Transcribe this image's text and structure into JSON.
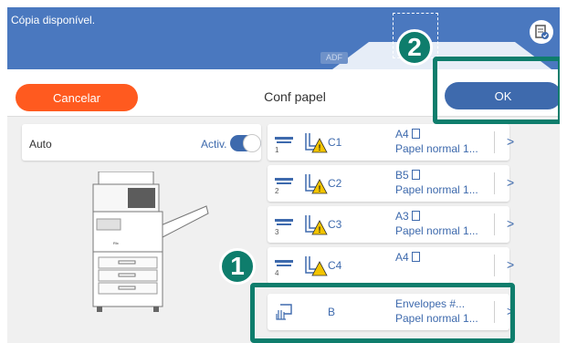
{
  "header": {
    "status": "Cópia disponível.",
    "adf_label": "ADF"
  },
  "toolbar": {
    "cancel_label": "Cancelar",
    "title": "Conf papel",
    "ok_label": "OK"
  },
  "auto": {
    "label": "Auto",
    "state_label": "Activ."
  },
  "trays": [
    {
      "num": "1",
      "name": "C1",
      "size": "A4",
      "type": "Papel normal 1..."
    },
    {
      "num": "2",
      "name": "C2",
      "size": "B5",
      "type": "Papel normal 1..."
    },
    {
      "num": "3",
      "name": "C3",
      "size": "A3",
      "type": "Papel normal 1..."
    },
    {
      "num": "4",
      "name": "C4",
      "size": "A4",
      "type": ""
    },
    {
      "num": "",
      "name": "B",
      "size": "Envelopes #...",
      "type": "Papel normal 1..."
    }
  ],
  "callouts": {
    "one": "1",
    "two": "2"
  },
  "colors": {
    "header_blue": "#4a78bf",
    "cancel_orange": "#ff5a1f",
    "ok_blue": "#3e6aad",
    "callout_green": "#0e7d6c"
  }
}
